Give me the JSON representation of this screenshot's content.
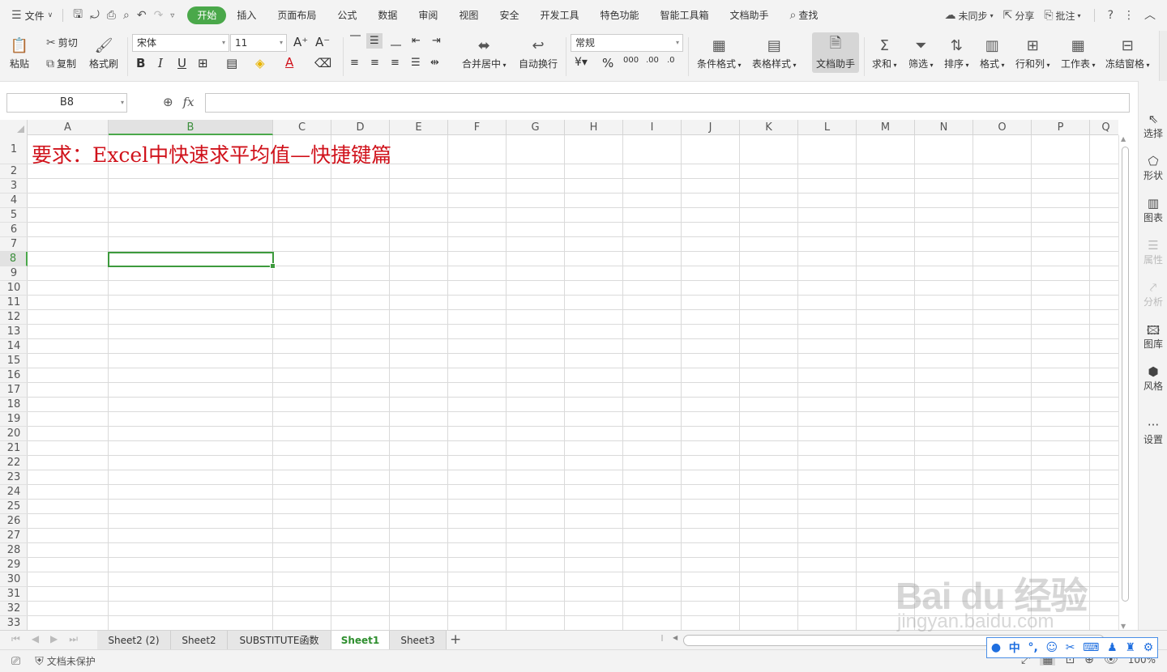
{
  "menu": {
    "file": "文件",
    "tabs": [
      "开始",
      "插入",
      "页面布局",
      "公式",
      "数据",
      "审阅",
      "视图",
      "安全",
      "开发工具",
      "特色功能",
      "智能工具箱",
      "文档助手"
    ],
    "search": "查找",
    "sync": "未同步",
    "share": "分享",
    "comment": "批注"
  },
  "ribbon": {
    "paste": "粘贴",
    "cut": "剪切",
    "copy": "复制",
    "format_painter": "格式刷",
    "font_name": "宋体",
    "font_size": "11",
    "number_format": "常规",
    "merge_center": "合并居中",
    "wrap_text": "自动换行",
    "conditional_format": "条件格式",
    "table_style": "表格样式",
    "doc_helper": "文档助手",
    "sum": "求和",
    "filter": "筛选",
    "sort": "排序",
    "format": "格式",
    "row_col": "行和列",
    "worksheet": "工作表",
    "freeze": "冻结窗格"
  },
  "formula_bar": {
    "name_box": "B8",
    "fx": "fx",
    "formula": ""
  },
  "grid": {
    "columns": [
      "A",
      "B",
      "C",
      "D",
      "E",
      "F",
      "G",
      "H",
      "I",
      "J",
      "K",
      "L",
      "M",
      "N",
      "O",
      "P",
      "Q"
    ],
    "rows": [
      "1",
      "2",
      "3",
      "4",
      "5",
      "6",
      "7",
      "8",
      "9",
      "10",
      "11",
      "12",
      "13",
      "14",
      "15",
      "16",
      "17",
      "18",
      "19",
      "20",
      "21",
      "22",
      "23",
      "24",
      "25",
      "26",
      "27",
      "28",
      "29",
      "30",
      "31",
      "32",
      "33"
    ],
    "cell_a1": "要求：Excel中快速求平均值—快捷键篇",
    "selected_column": "B",
    "selected_row": "8"
  },
  "right_pane": [
    "选择",
    "形状",
    "图表",
    "属性",
    "分析",
    "图库",
    "风格",
    "设置"
  ],
  "sheets": {
    "tabs": [
      "Sheet2 (2)",
      "Sheet2",
      "SUBSTITUTE函数",
      "Sheet1",
      "Sheet3"
    ],
    "active": "Sheet1"
  },
  "status": {
    "protection": "文档未保护",
    "zoom": "100%"
  },
  "watermark": {
    "logo": "Bai du 经验",
    "url": "jingyan.baidu.com"
  },
  "colors": {
    "accent": "#4aa84a",
    "title_text": "#d0121b",
    "ime_blue": "#1f6fe0"
  }
}
